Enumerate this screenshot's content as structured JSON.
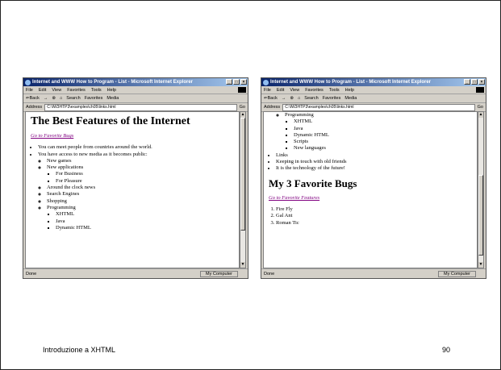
{
  "browser": {
    "title": "Internet and WWW How to Program - List - Microsoft Internet Explorer",
    "menu": [
      "File",
      "Edit",
      "View",
      "Favorites",
      "Tools",
      "Help"
    ],
    "toolbar": [
      "⇐Back",
      "→",
      "⊗",
      "⌂",
      "Search",
      "Favorites",
      "Media"
    ],
    "address_label": "Address",
    "address": "C:\\IW3HTP3\\examples\\ch05\\links.html",
    "go_label": "Go",
    "status_done": "Done",
    "status_zone": "My Computer"
  },
  "left_page": {
    "heading": "The Best Features of the Internet",
    "link": "Go to Favorite Bugs",
    "items": [
      "You can meet people from countries around the world.",
      "You have access to new media as it becomes public:"
    ],
    "sub1": [
      "New games",
      "New applications"
    ],
    "sub1b": [
      "For Business",
      "For Pleasure"
    ],
    "sub2": [
      "Around the clock news",
      "Search Engines",
      "Shopping",
      "Programming"
    ],
    "prog": [
      "XHTML",
      "Java",
      "Dynamic HTML"
    ]
  },
  "right_page": {
    "sub": "Programming",
    "prog": [
      "XHTML",
      "Java",
      "Dynamic HTML",
      "Scripts",
      "New languages"
    ],
    "items": [
      "Links",
      "Keeping in touch with old friends",
      "It is the technology of the future!"
    ],
    "heading": "My 3 Favorite Bugs",
    "link": "Go to Favorite Features",
    "bugs": [
      "Fire Fly",
      "Gal Ant",
      "Roman Tic"
    ]
  },
  "footer": {
    "title": "Introduzione a XHTML",
    "page": "90"
  }
}
